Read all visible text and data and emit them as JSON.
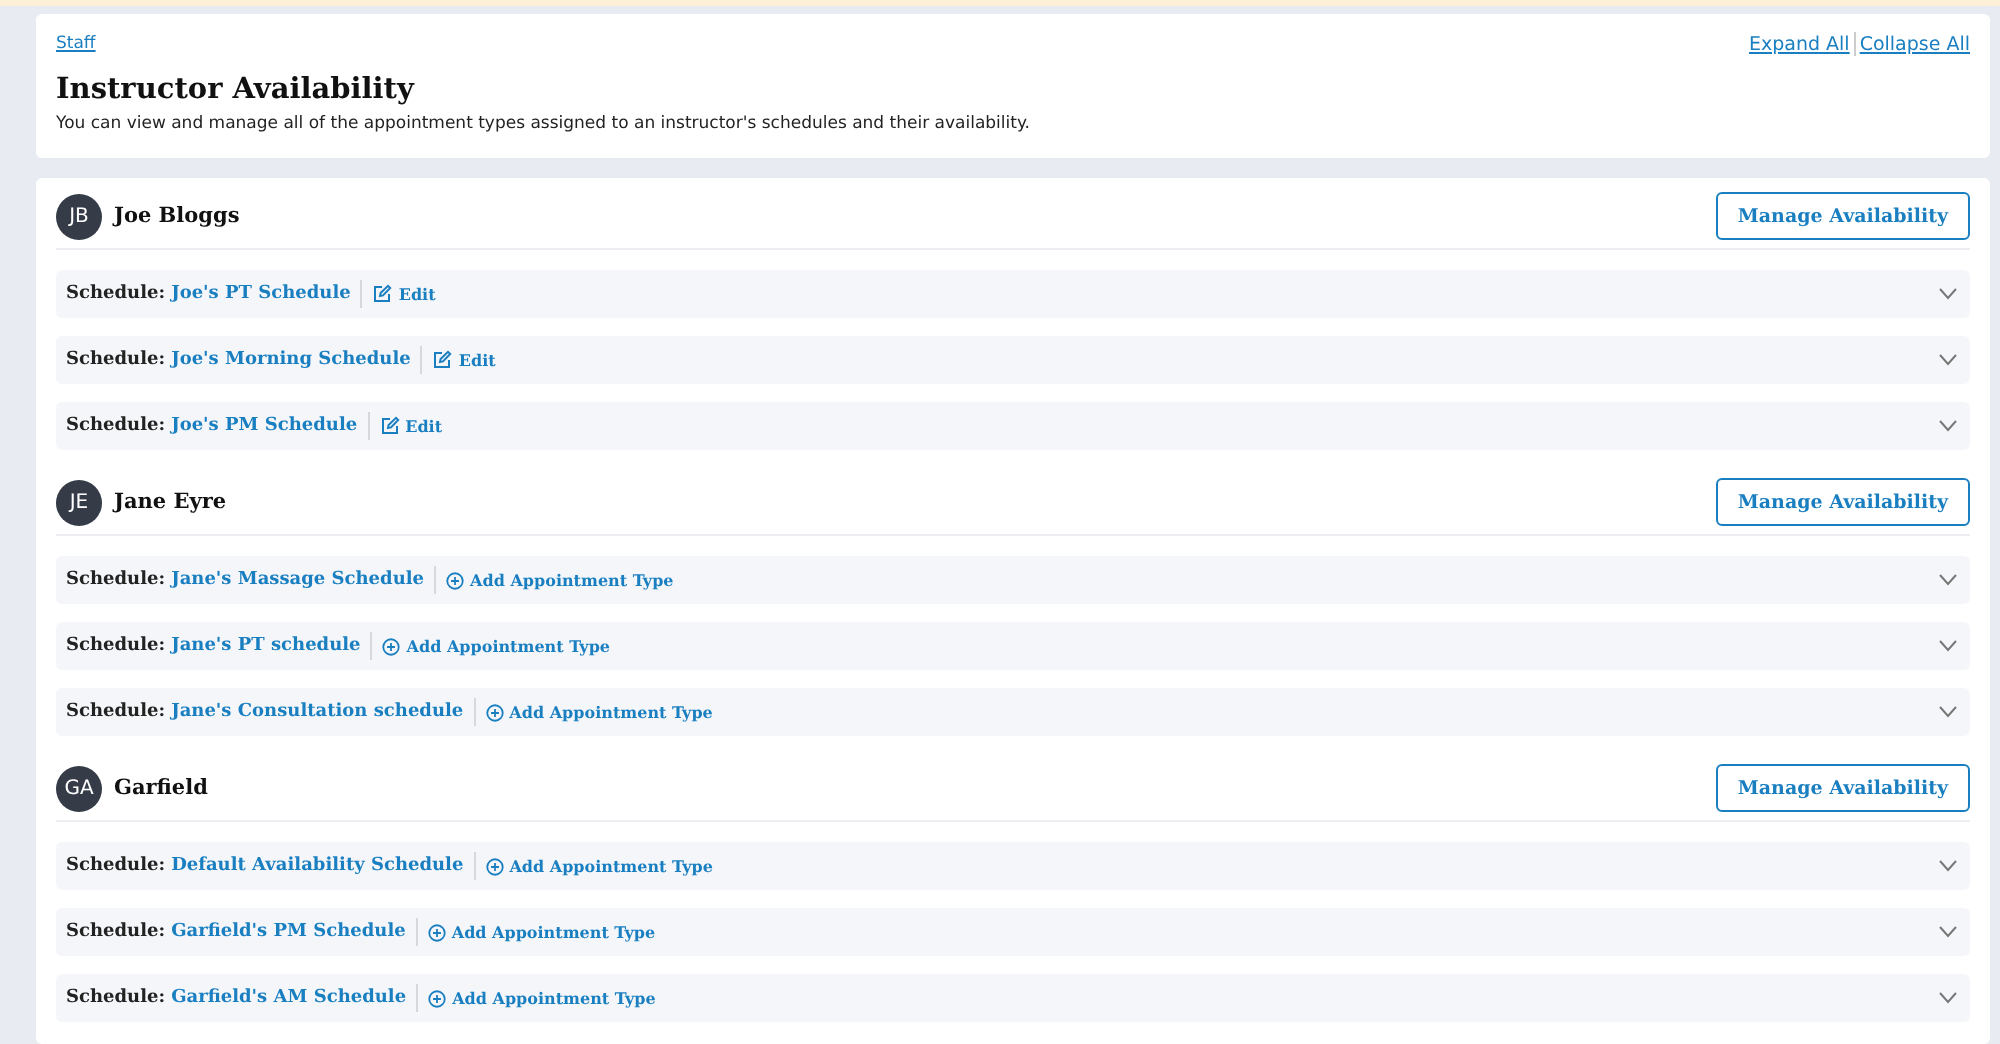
{
  "breadcrumb": "Staff",
  "header_links": [
    "Expand All",
    "Collapse All"
  ],
  "title": "Instructor Availability",
  "description": "You can view and manage all of the appointment types assigned to an instructor's schedules and their availability.",
  "instructors": [
    {
      "initials": "JB",
      "name": "Joe Bloggs",
      "button": "Manage Availability",
      "schedules": [
        {
          "label": "Schedule:",
          "name": "Joe's PT Schedule",
          "action": {
            "kind": "edit",
            "text": "Edit"
          },
          "expanded": false
        },
        {
          "label": "Schedule:",
          "name": "Joe's Morning Schedule",
          "action": {
            "kind": "edit",
            "text": "Edit"
          },
          "expanded": false
        },
        {
          "label": "Schedule:",
          "name": "Joe's PM Schedule",
          "action": {
            "kind": "edit",
            "text": "Edit"
          },
          "expanded": false
        }
      ]
    },
    {
      "initials": "JE",
      "name": "Jane Eyre",
      "button": "Manage Availability",
      "schedules": [
        {
          "label": "Schedule:",
          "name": "Jane's Massage Schedule",
          "action": {
            "kind": "add",
            "text": "Add Appointment Type"
          },
          "expanded": false
        },
        {
          "label": "Schedule:",
          "name": "Jane's PT schedule",
          "action": {
            "kind": "add",
            "text": "Add Appointment Type"
          },
          "expanded": false
        },
        {
          "label": "Schedule:",
          "name": "Jane's Consultation schedule",
          "action": {
            "kind": "add",
            "text": "Add Appointment Type"
          },
          "expanded": false
        }
      ]
    },
    {
      "initials": "GA",
      "name": "Garfield",
      "button": "Manage Availability",
      "schedules": [
        {
          "label": "Schedule:",
          "name": "Default Availability Schedule",
          "action": {
            "kind": "add",
            "text": "Add Appointment Type"
          },
          "expanded": false
        },
        {
          "label": "Schedule:",
          "name": "Garfield's PM Schedule",
          "action": {
            "kind": "add",
            "text": "Add Appointment Type"
          },
          "expanded": false
        },
        {
          "label": "Schedule:",
          "name": "Garfield's AM Schedule",
          "action": {
            "kind": "add",
            "text": "Add Appointment Type"
          },
          "expanded": false
        }
      ]
    }
  ]
}
